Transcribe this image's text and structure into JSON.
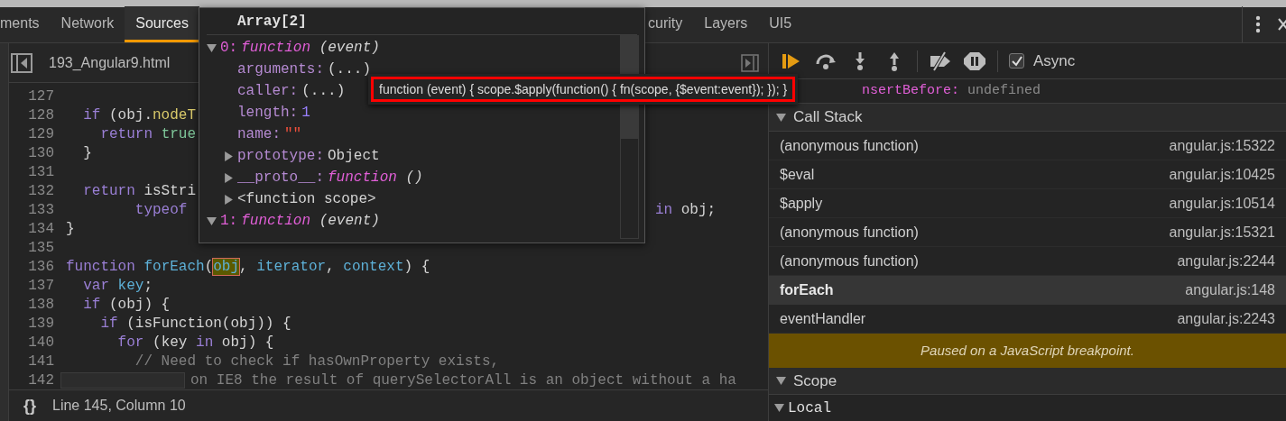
{
  "tabs": [
    {
      "label": "ments",
      "selected": false
    },
    {
      "label": "Network",
      "selected": false
    },
    {
      "label": "Sources",
      "selected": true
    },
    {
      "label": "curity",
      "selected": false
    },
    {
      "label": "Layers",
      "selected": false
    },
    {
      "label": "UI5",
      "selected": false
    }
  ],
  "editor": {
    "file_name": "193_Angular9.html",
    "lines": [
      {
        "number": "127"
      },
      {
        "number": "128",
        "segments": [
          {
            "text": "  if",
            "kind": "keyword"
          },
          {
            "text": " (obj.",
            "kind": "plain"
          },
          {
            "text": "nodeT",
            "kind": "property"
          }
        ]
      },
      {
        "number": "129",
        "segments": [
          {
            "text": "    return ",
            "kind": "keyword"
          },
          {
            "text": "true",
            "kind": "literal"
          }
        ]
      },
      {
        "number": "130",
        "segments": [
          {
            "text": "  }",
            "kind": "plain"
          }
        ]
      },
      {
        "number": "131"
      },
      {
        "number": "132",
        "segments": [
          {
            "text": "  return",
            "kind": "keyword"
          },
          {
            "text": " isStri",
            "kind": "plain"
          }
        ]
      },
      {
        "number": "133",
        "segments": [
          {
            "text": "        typeof",
            "kind": "keyword"
          }
        ],
        "tail": [
          {
            "text": "in",
            "kind": "keyword"
          },
          {
            "text": " obj;",
            "kind": "plain"
          }
        ]
      },
      {
        "number": "134",
        "segments": [
          {
            "text": "}",
            "kind": "plain"
          }
        ]
      },
      {
        "number": "135"
      },
      {
        "number": "136",
        "segments": [
          {
            "text": "function ",
            "kind": "keyword"
          },
          {
            "text": "forEach",
            "kind": "definition"
          },
          {
            "text": "(",
            "kind": "plain"
          },
          {
            "text": "obj",
            "kind": "highlight"
          },
          {
            "text": ", ",
            "kind": "plain"
          },
          {
            "text": "iterator",
            "kind": "definition"
          },
          {
            "text": ", ",
            "kind": "plain"
          },
          {
            "text": "context",
            "kind": "definition"
          },
          {
            "text": ") {",
            "kind": "plain"
          }
        ]
      },
      {
        "number": "137",
        "segments": [
          {
            "text": "  var ",
            "kind": "keyword"
          },
          {
            "text": "key",
            "kind": "definition"
          },
          {
            "text": ";",
            "kind": "plain"
          }
        ]
      },
      {
        "number": "138",
        "segments": [
          {
            "text": "  if",
            "kind": "keyword"
          },
          {
            "text": " (obj) {",
            "kind": "plain"
          }
        ]
      },
      {
        "number": "139",
        "segments": [
          {
            "text": "    if",
            "kind": "keyword"
          },
          {
            "text": " (isFunction(obj)) {",
            "kind": "plain"
          }
        ]
      },
      {
        "number": "140",
        "segments": [
          {
            "text": "      for",
            "kind": "keyword"
          },
          {
            "text": " (key ",
            "kind": "plain"
          },
          {
            "text": "in",
            "kind": "keyword"
          },
          {
            "text": " obj) {",
            "kind": "plain"
          }
        ]
      },
      {
        "number": "141",
        "segments": [
          {
            "text": "        // Need to check if hasOwnProperty exists,",
            "kind": "comment"
          }
        ]
      },
      {
        "number": "142",
        "widget": true,
        "segments": [
          {
            "text": "on IE8 the result of querySelectorAll is an object without a ha",
            "kind": "comment"
          }
        ]
      }
    ]
  },
  "status_bar": {
    "pretty_print": "{}",
    "position": "Line 145, Column 10"
  },
  "popover": {
    "title": "Array[2]",
    "items": [
      {
        "key": "0:",
        "kind": "function",
        "keyword": "function",
        "signature": "(event)",
        "expanded": true,
        "children": [
          {
            "key": "arguments:",
            "kind": "accessor",
            "value": "(...)"
          },
          {
            "key": "caller:",
            "kind": "accessor",
            "value": "(...)"
          },
          {
            "key": "length:",
            "kind": "number",
            "value": "1"
          },
          {
            "key": "name:",
            "kind": "string",
            "value": "\"\""
          },
          {
            "key": "prototype:",
            "kind": "object",
            "value": "Object",
            "expanded": false
          },
          {
            "key": "__proto__:",
            "kind": "function",
            "keyword": "function",
            "signature": "()",
            "expanded": false
          },
          {
            "kind": "scope",
            "value": "<function scope>",
            "expanded": false
          }
        ]
      },
      {
        "key": "1:",
        "kind": "function",
        "keyword": "function",
        "signature": "(event)",
        "expanded": true
      }
    ]
  },
  "tooltip": {
    "text": "function (event) { scope.$apply(function() { fn(scope, {$event:event}); }); }"
  },
  "debugger": {
    "async": {
      "label": "Async",
      "checked": true
    },
    "scope_row": {
      "key": "nsertBefore:",
      "value": "undefined"
    },
    "call_stack": {
      "title": "Call Stack",
      "expanded": true,
      "frames": [
        {
          "name": "(anonymous function)",
          "location": "angular.js:15322",
          "selected": false
        },
        {
          "name": "$eval",
          "location": "angular.js:10425",
          "selected": false
        },
        {
          "name": "$apply",
          "location": "angular.js:10514",
          "selected": false
        },
        {
          "name": "(anonymous function)",
          "location": "angular.js:15321",
          "selected": false
        },
        {
          "name": "(anonymous function)",
          "location": "angular.js:2244",
          "selected": false
        },
        {
          "name": "forEach",
          "location": "angular.js:148",
          "selected": true
        },
        {
          "name": "eventHandler",
          "location": "angular.js:2243",
          "selected": false
        }
      ]
    },
    "paused_message": "Paused on a JavaScript breakpoint.",
    "scope": {
      "title": "Scope",
      "expanded": true
    },
    "local": {
      "title": "Local",
      "expanded": true
    }
  }
}
